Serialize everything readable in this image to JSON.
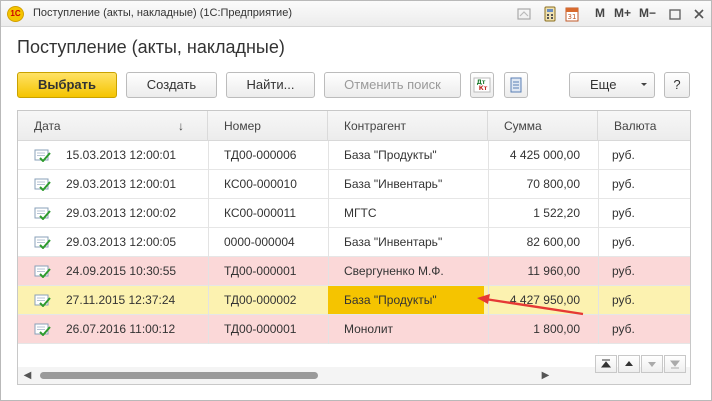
{
  "window": {
    "app_logo_text": "1С",
    "title": "Поступление (акты, накладные)  (1С:Предприятие)",
    "controls": {
      "m": "M",
      "m_plus": "M+",
      "m_minus": "M−"
    }
  },
  "header": {
    "title": "Поступление (акты, накладные)"
  },
  "toolbar": {
    "select": "Выбрать",
    "create": "Создать",
    "find": "Найти...",
    "cancel_search": "Отменить поиск",
    "dt_kt_icon": "Дт Кт",
    "more": "Еще",
    "help": "?"
  },
  "table": {
    "columns": [
      "Дата",
      "Номер",
      "Контрагент",
      "Сумма",
      "Валюта"
    ],
    "sort_indicator": "↓",
    "rows": [
      {
        "date": "15.03.2013 12:00:01",
        "number": "ТД00-000006",
        "counterparty": "База \"Продукты\"",
        "sum": "4 425 000,00",
        "currency": "руб.",
        "state": "normal"
      },
      {
        "date": "29.03.2013 12:00:01",
        "number": "КС00-000010",
        "counterparty": "База \"Инвентарь\"",
        "sum": "70 800,00",
        "currency": "руб.",
        "state": "normal"
      },
      {
        "date": "29.03.2013 12:00:02",
        "number": "КС00-000011",
        "counterparty": "МГТС",
        "sum": "1 522,20",
        "currency": "руб.",
        "state": "normal"
      },
      {
        "date": "29.03.2013 12:00:05",
        "number": "0000-000004",
        "counterparty": "База \"Инвентарь\"",
        "sum": "82 600,00",
        "currency": "руб.",
        "state": "normal"
      },
      {
        "date": "24.09.2015 10:30:55",
        "number": "ТД00-000001",
        "counterparty": "Свергуненко М.Ф.",
        "sum": "11 960,00",
        "currency": "руб.",
        "state": "highlight"
      },
      {
        "date": "27.11.2015 12:37:24",
        "number": "ТД00-000002",
        "counterparty": "База \"Продукты\"",
        "sum": "4 427 950,00",
        "currency": "руб.",
        "state": "selected"
      },
      {
        "date": "26.07.2016 11:00:12",
        "number": "ТД00-000001",
        "counterparty": "Монолит",
        "sum": "1 800,00",
        "currency": "руб.",
        "state": "highlight"
      }
    ]
  },
  "colors": {
    "accent": "#f5c400",
    "row_highlight": "#fbd8d8",
    "row_selected": "#fcf2b0",
    "annotation_arrow": "#e53935"
  },
  "icons": {
    "row_icon": "document-posted-icon",
    "nav": [
      "first-page-icon",
      "prev-page-icon",
      "next-page-icon",
      "last-page-icon"
    ]
  }
}
